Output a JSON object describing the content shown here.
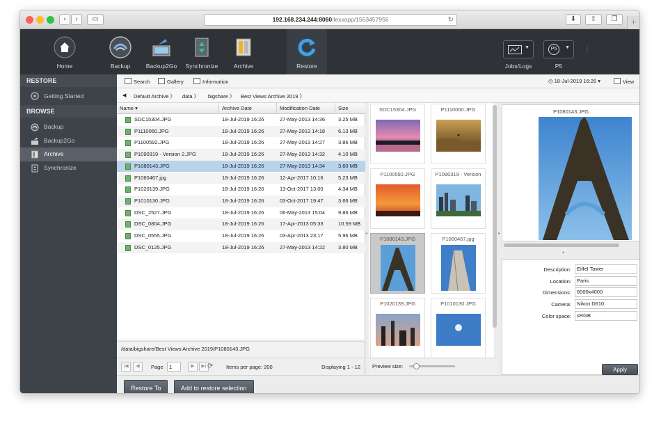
{
  "browser": {
    "url_host": "192.168.234.244:8060",
    "url_path": "/lexxapp/1563457956"
  },
  "toolbar": {
    "items": [
      {
        "label": "Home",
        "icon": "home-icon"
      },
      {
        "label": "Backup",
        "icon": "backup-icon"
      },
      {
        "label": "Backup2Go",
        "icon": "backup2go-icon"
      },
      {
        "label": "Synchronize",
        "icon": "synchronize-icon"
      },
      {
        "label": "Archive",
        "icon": "archive-icon"
      },
      {
        "label": "Restore",
        "icon": "restore-icon",
        "active": true
      }
    ],
    "jobs_label": "Jobs/Logs",
    "user_label": "P5",
    "user_badge": "P5"
  },
  "sidebar": {
    "restore_header": "RESTORE",
    "restore_items": [
      {
        "label": "Getting Started"
      }
    ],
    "browse_header": "BROWSE",
    "browse_items": [
      {
        "label": "Backup"
      },
      {
        "label": "Backup2Go"
      },
      {
        "label": "Archive",
        "active": true
      },
      {
        "label": "Synchronize"
      }
    ]
  },
  "subbar": {
    "search": "Search",
    "gallery": "Gallery",
    "information": "Information",
    "date": "18-Jul-2019 16:26",
    "view": "View"
  },
  "breadcrumb": [
    "Default Archive",
    "data",
    "bigshare",
    "Best Views Archive 2019"
  ],
  "table": {
    "headers": [
      "Name",
      "Archive Date",
      "Modification Date",
      "Size"
    ],
    "rows": [
      [
        "SDC15304.JPG",
        "18-Jul-2019 16:26",
        "27-May-2013 14:36",
        "3.25 MB"
      ],
      [
        "P1110060.JPG",
        "18-Jul-2019 16:26",
        "27-May-2013 14:18",
        "6.13 MB"
      ],
      [
        "P1100592.JPG",
        "18-Jul-2019 16:26",
        "27-May-2013 14:27",
        "3.86 MB"
      ],
      [
        "P1090319 - Version 2.JPG",
        "18-Jul-2019 16:26",
        "27-May-2013 14:32",
        "4.10 MB"
      ],
      [
        "P1080143.JPG",
        "18-Jul-2019 16:26",
        "27-May-2013 14:34",
        "3.60 MB"
      ],
      [
        "P1060467.jpg",
        "18-Jul-2019 16:26",
        "12-Apr-2017 10:16",
        "5.23 MB"
      ],
      [
        "P1020139.JPG",
        "18-Jul-2019 16:26",
        "13-Oct-2017 13:00",
        "4.34 MB"
      ],
      [
        "P1010130.JPG",
        "18-Jul-2019 16:26",
        "03-Oct-2017 19:47",
        "3.66 MB"
      ],
      [
        "DSC_2527.JPG",
        "18-Jul-2019 16:26",
        "06-May-2013 15:04",
        "9.86 MB"
      ],
      [
        "DSC_0804.JPG",
        "18-Jul-2019 16:26",
        "17-Apr-2013 05:33",
        "10.59 MB"
      ],
      [
        "DSC_0555.JPG",
        "18-Jul-2019 16:26",
        "03-Apr-2013 23:17",
        "5.96 MB"
      ],
      [
        "DSC_0125.JPG",
        "18-Jul-2019 16:26",
        "27-May-2013 14:22",
        "3.80 MB"
      ]
    ],
    "selected_index": 4
  },
  "path": "/data/bigshare/Best Views Archive 2019/P1080143.JPG",
  "pager": {
    "page_label": "Page",
    "page_value": "1",
    "items_per_page": "Items per page: 200",
    "displaying": "Displaying 1 - 12"
  },
  "gallery": {
    "thumbs": [
      {
        "name": "SDC15304.JPG"
      },
      {
        "name": "P1110060.JPG"
      },
      {
        "name": "P1100592.JPG"
      },
      {
        "name": "P1090319 - Version"
      },
      {
        "name": "P1080143.JPG",
        "selected": true
      },
      {
        "name": "P1060467.jpg"
      },
      {
        "name": "P1020139.JPG"
      },
      {
        "name": "P1010130.JPG"
      }
    ],
    "preview_size_label": "Preview size:",
    "preview_size_fraction": 0.15
  },
  "preview": {
    "name": "P1080143.JPG"
  },
  "properties": [
    {
      "key": "Description:",
      "value": "Eiffel Tower"
    },
    {
      "key": "Location:",
      "value": "Paris"
    },
    {
      "key": "Dimensions:",
      "value": "6000x4000"
    },
    {
      "key": "Camera:",
      "value": "Nikon D610"
    },
    {
      "key": "Color space:",
      "value": "sRGB"
    }
  ],
  "actions": {
    "apply": "Apply",
    "restore_to": "Restore To",
    "add_to_restore": "Add to restore selection"
  }
}
